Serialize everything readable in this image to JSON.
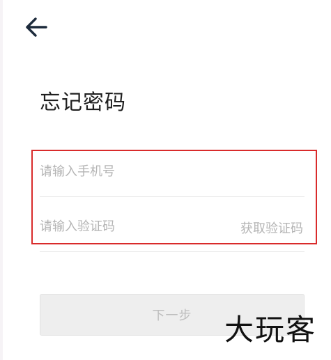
{
  "header": {
    "back_icon": "arrow-left-icon"
  },
  "title": "忘记密码",
  "form": {
    "phone": {
      "value": "",
      "placeholder": "请输入手机号"
    },
    "code": {
      "value": "",
      "placeholder": "请输入验证码"
    },
    "get_code_label": "获取验证码"
  },
  "next_button_label": "下一步",
  "watermark": "大玩客",
  "colors": {
    "highlight_border": "#d92b2b",
    "placeholder": "#b4b4b4",
    "button_bg": "#eeeeee"
  }
}
